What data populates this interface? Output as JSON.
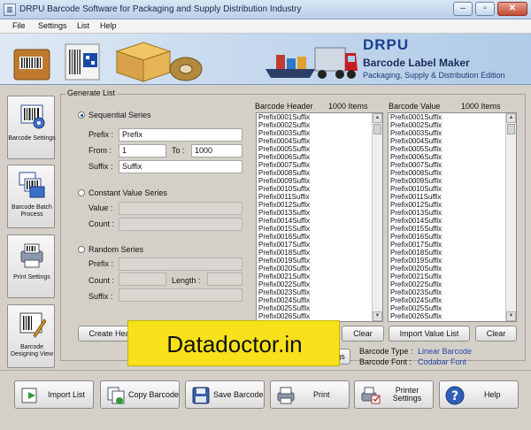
{
  "window": {
    "title": "DRPU Barcode Software for Packaging and Supply Distribution Industry"
  },
  "menu": [
    "File",
    "Settings",
    "List",
    "Help"
  ],
  "banner": {
    "logo": "DRPU",
    "product": "Barcode Label Maker",
    "edition": "Packaging, Supply & Distribution Edition"
  },
  "sidebar": [
    {
      "label": "Barcode Settings",
      "icon": "barcode-settings-icon"
    },
    {
      "label": "Barcode Batch Process",
      "icon": "batch-process-icon"
    },
    {
      "label": "Print Settings",
      "icon": "print-settings-icon"
    },
    {
      "label": "Barcode Designing View",
      "icon": "designing-view-icon"
    }
  ],
  "generate": {
    "title": "Generate List",
    "sequential": {
      "label": "Sequential Series",
      "selected": true,
      "prefix_label": "Prefix :",
      "prefix": "Prefix",
      "from_label": "From :",
      "from": "1",
      "to_label": "To :",
      "to": "1000",
      "suffix_label": "Suffix :",
      "suffix": "Suffix"
    },
    "constant": {
      "label": "Constant Value Series",
      "value_label": "Value :",
      "count_label": "Count :"
    },
    "random": {
      "label": "Random Series",
      "prefix_label": "Prefix :",
      "count_label": "Count :",
      "length_label": "Length :",
      "suffix_label": "Suffix :"
    }
  },
  "header_list": {
    "title": "Barcode Header",
    "count": "1000 Items"
  },
  "value_list": {
    "title": "Barcode Value",
    "count": "1000 Items"
  },
  "list_items": [
    "Prefix0001Suffix",
    "Prefix0002Suffix",
    "Prefix0003Suffix",
    "Prefix0004Suffix",
    "Prefix0005Suffix",
    "Prefix0006Suffix",
    "Prefix0007Suffix",
    "Prefix0008Suffix",
    "Prefix0009Suffix",
    "Prefix0010Suffix",
    "Prefix0011Suffix",
    "Prefix0012Suffix",
    "Prefix0013Suffix",
    "Prefix0014Suffix",
    "Prefix0015Suffix",
    "Prefix0016Suffix",
    "Prefix0017Suffix",
    "Prefix0018Suffix",
    "Prefix0019Suffix",
    "Prefix0020Suffix",
    "Prefix0021Suffix",
    "Prefix0022Suffix",
    "Prefix0023Suffix",
    "Prefix0024Suffix",
    "Prefix0025Suffix",
    "Prefix0026Suffix"
  ],
  "buttons": {
    "create_header": "Create Header",
    "clear_header": "Clear",
    "import_value": "Import Value List",
    "clear_value": "Clear",
    "settings_partial": "gs"
  },
  "barcode_info": {
    "type_label": "Barcode Type :",
    "type": "Linear Barcode",
    "font_label": "Barcode Font :",
    "font": "Codabar Font"
  },
  "watermark": "Datadoctor.in",
  "toolbar": {
    "import_list": "Import List",
    "copy_barcode": "Copy Barcode",
    "save_barcode": "Save Barcode",
    "print": "Print",
    "printer_settings_1": "Printer",
    "printer_settings_2": "Settings",
    "help": "Help"
  }
}
